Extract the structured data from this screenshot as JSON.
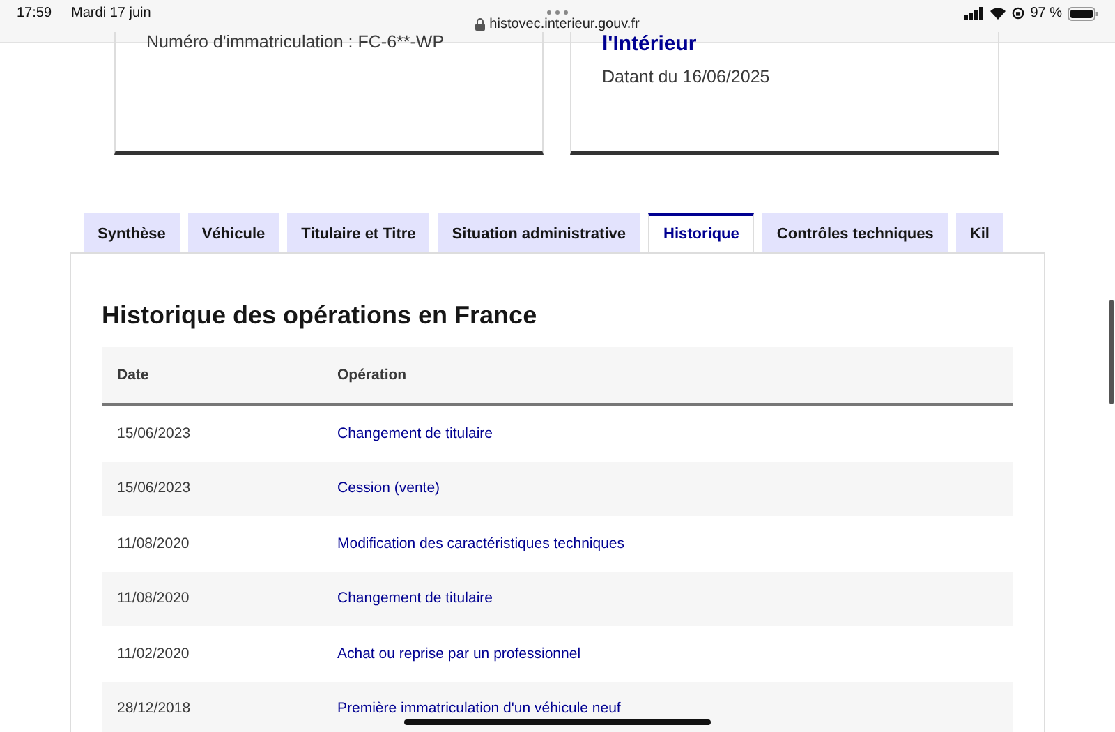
{
  "status_bar": {
    "time": "17:59",
    "date": "Mardi 17 juin",
    "url": "histovec.interieur.gouv.fr",
    "battery": "97 %"
  },
  "cards": [
    {
      "texts": [
        {
          "kind": "plain",
          "text": "Numéro d'immatriculation : FC-6**-WP"
        }
      ]
    },
    {
      "texts": [
        {
          "kind": "heading",
          "text": "l'Intérieur"
        },
        {
          "kind": "plain",
          "text": "Datant du 16/06/2025"
        }
      ]
    }
  ],
  "tabs": [
    {
      "label": "Synthèse",
      "selected": false
    },
    {
      "label": "Véhicule",
      "selected": false
    },
    {
      "label": "Titulaire et Titre",
      "selected": false
    },
    {
      "label": "Situation administrative",
      "selected": false
    },
    {
      "label": "Historique",
      "selected": true
    },
    {
      "label": "Contrôles techniques",
      "selected": false
    },
    {
      "label": "Kil",
      "selected": false
    }
  ],
  "section": {
    "title": "Historique des opérations en France",
    "table": {
      "columns": [
        "Date",
        "Opération"
      ],
      "rows": [
        {
          "date": "15/06/2023",
          "operation": "Changement de titulaire"
        },
        {
          "date": "15/06/2023",
          "operation": "Cession (vente)"
        },
        {
          "date": "11/08/2020",
          "operation": "Modification des caractéristiques techniques"
        },
        {
          "date": "11/08/2020",
          "operation": "Changement de titulaire"
        },
        {
          "date": "11/02/2020",
          "operation": "Achat ou reprise par un professionnel"
        },
        {
          "date": "28/12/2018",
          "operation": "Première immatriculation d'un véhicule neuf"
        }
      ]
    }
  }
}
